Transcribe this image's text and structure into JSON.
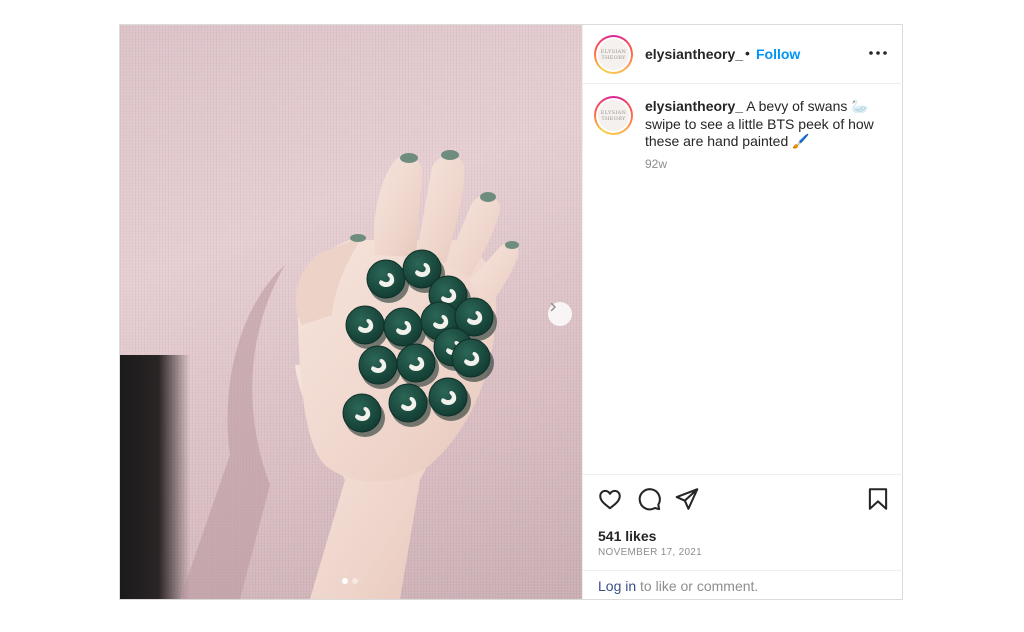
{
  "post": {
    "username": "elysiantheory_",
    "follow_label": "Follow",
    "separator": "•",
    "avatar_text_1": "ELYSIAN",
    "avatar_text_2": "THEORY",
    "caption_text": "A bevy of swans 🦢 swipe to see a little BTS peek of how these are hand painted 🖌️",
    "caption_age": "92w",
    "likes": "541 likes",
    "date": "NOVEMBER 17, 2021",
    "login_link": "Log in",
    "login_rest": " to like or comment."
  },
  "carousel": {
    "total": 2,
    "active": 1
  },
  "icons": {
    "more": "more-options-icon",
    "like": "heart-icon",
    "comment": "comment-icon",
    "share": "share-icon",
    "save": "bookmark-icon",
    "next": "chevron-right-icon"
  },
  "colors": {
    "link_blue": "#0095f6",
    "text": "#262626",
    "muted": "#8e8e8e",
    "login_blue": "#385185",
    "badge_green": "#1d4a3f"
  }
}
